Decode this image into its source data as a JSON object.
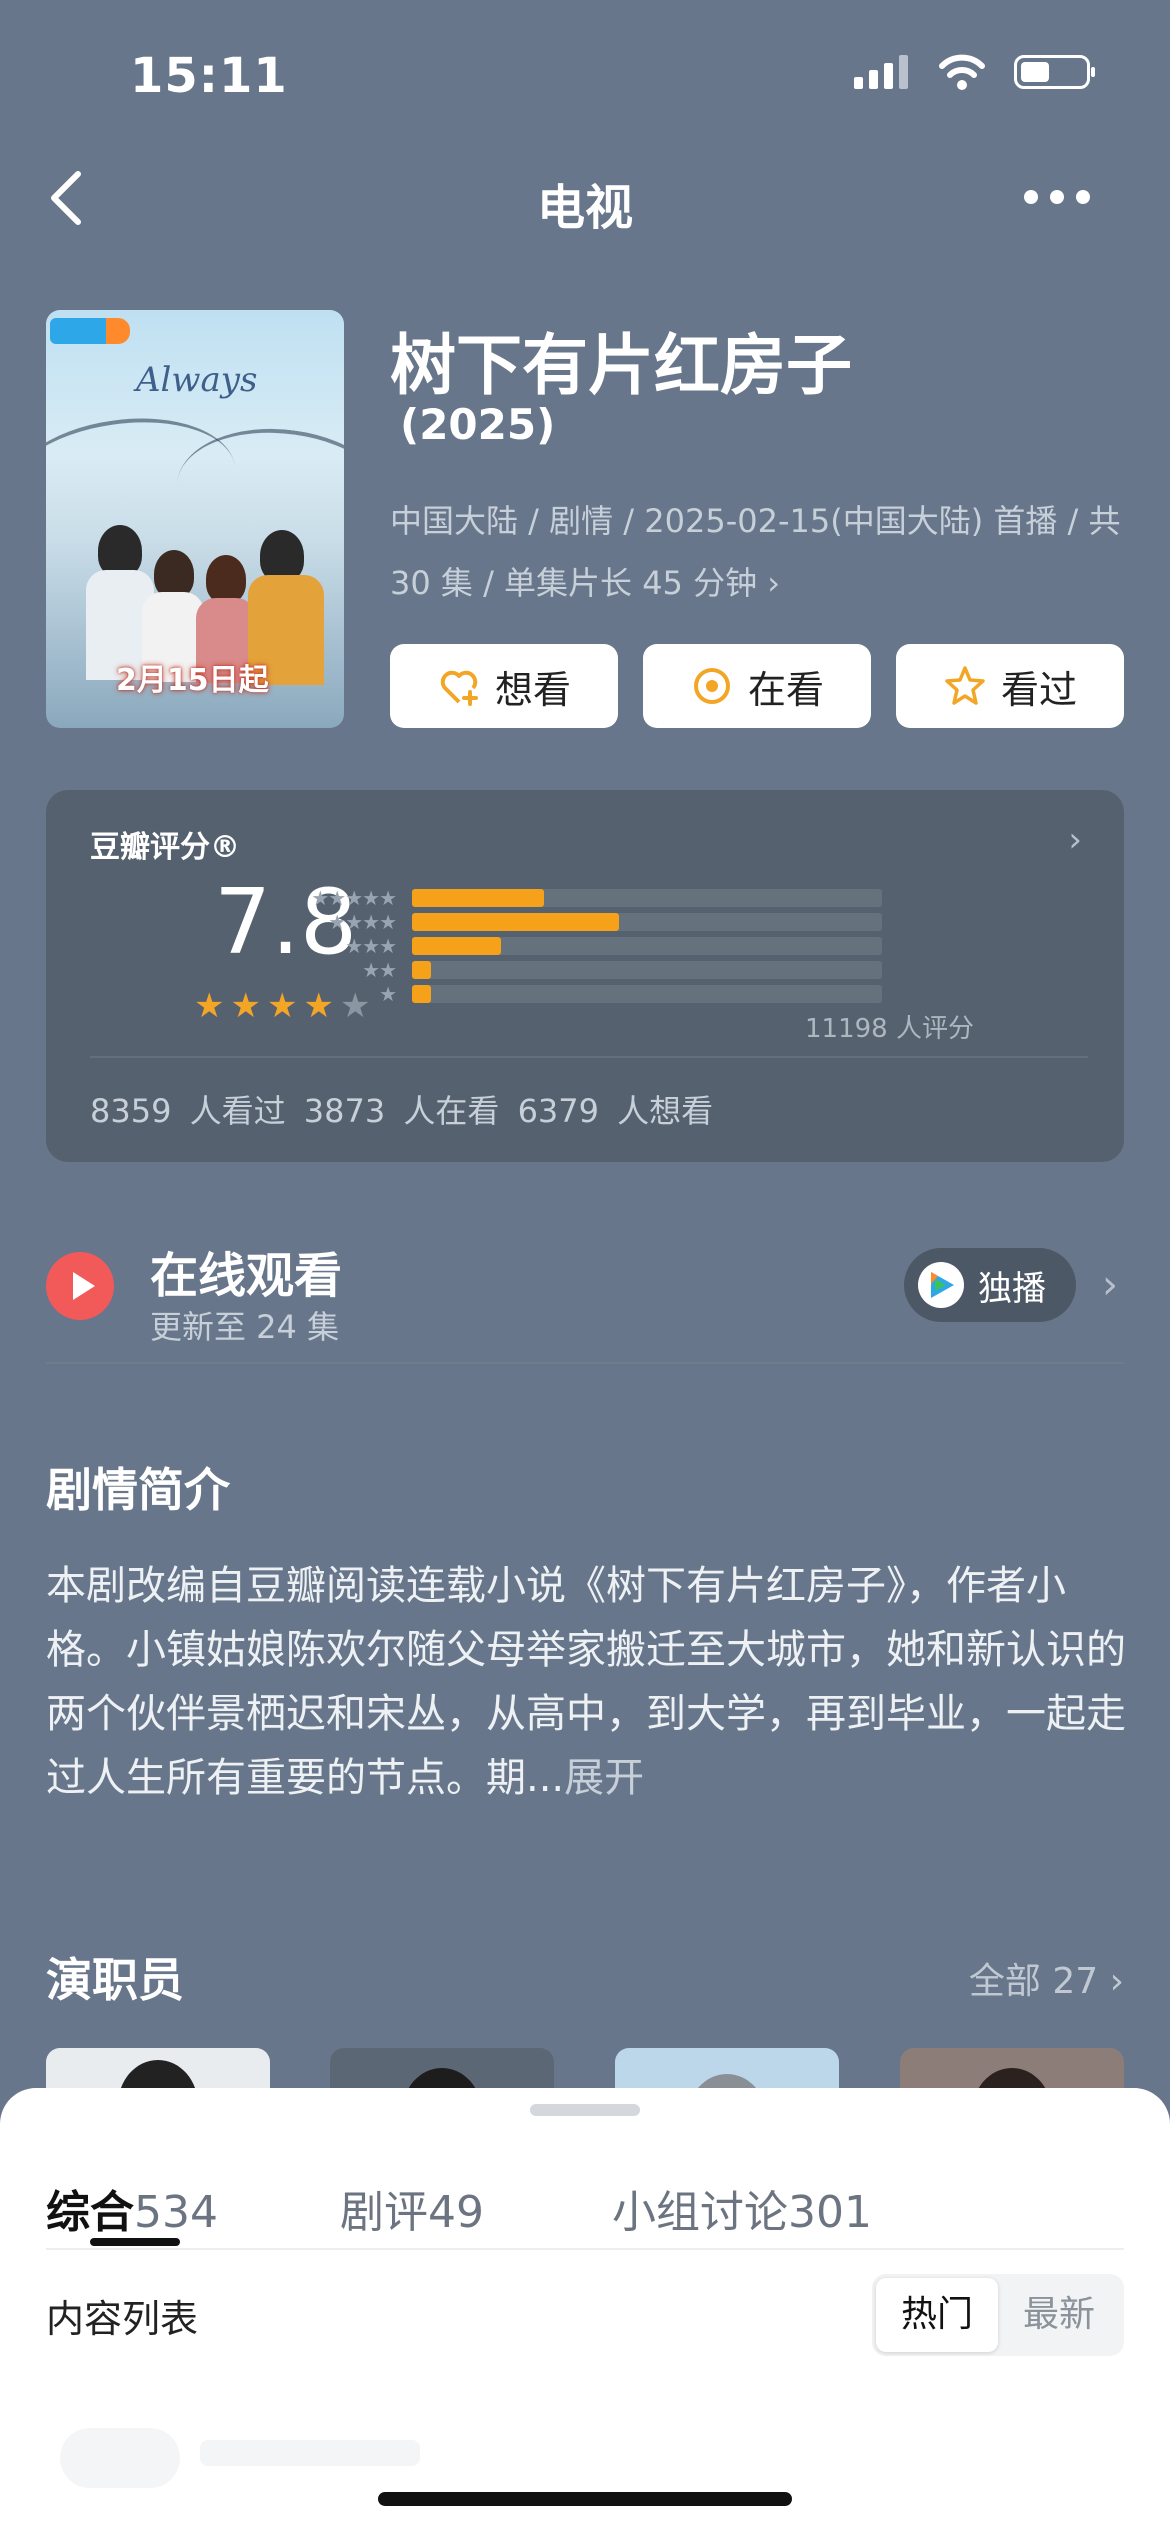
{
  "status_bar": {
    "time": "15:11"
  },
  "nav": {
    "title": "电视"
  },
  "show": {
    "title": "树下有片红房子",
    "year": "(2025)",
    "meta": "中国大陆 / 剧情 / 2025-02-15(中国大陆) 首播 / 共 30 集 / 单集片长 45 分钟 ›",
    "poster": {
      "script_text": "Always",
      "date_text": "2月15日起"
    }
  },
  "actions": [
    {
      "label": "想看",
      "icon": "heart-plus-icon"
    },
    {
      "label": "在看",
      "icon": "eye-circle-icon"
    },
    {
      "label": "看过",
      "icon": "star-outline-icon"
    }
  ],
  "rating": {
    "title": "豆瓣评分®",
    "score": "7.8",
    "stars": 4,
    "count_text": "11198 人评分",
    "distribution": [
      {
        "stars": "★★★★★",
        "fraction": 0.28
      },
      {
        "stars": "★★★★",
        "fraction": 0.44
      },
      {
        "stars": "★★★",
        "fraction": 0.19
      },
      {
        "stars": "★★",
        "fraction": 0.04
      },
      {
        "stars": "★",
        "fraction": 0.04
      }
    ],
    "stats": "8359 人看过   3873 人在看   6379 人想看"
  },
  "online": {
    "title": "在线观看",
    "subtitle": "更新至 24 集",
    "badge": "独播"
  },
  "synopsis": {
    "title": "剧情简介",
    "text": "本剧改编自豆瓣阅读连载小说《树下有片红房子》，作者小格。小镇姑娘陈欢尔随父母举家搬迁至大城市，她和新认识的两个伙伴景栖迟和宋丛，从高中，到大学，再到毕业，一起走过人生所有重要的节点。期...",
    "expand": "展开"
  },
  "cast": {
    "title": "演职员",
    "all_label": "全部 27 ›"
  },
  "sheet": {
    "tabs": [
      {
        "label": "综合",
        "count": "534"
      },
      {
        "label": "剧评",
        "count": "49"
      },
      {
        "label": "小组讨论",
        "count": "301"
      }
    ],
    "list_label": "内容列表",
    "sort": {
      "hot": "热门",
      "new": "最新"
    }
  },
  "colors": {
    "accent": "#f5a21a",
    "play": "#f25a5a",
    "background": "#67768a"
  }
}
